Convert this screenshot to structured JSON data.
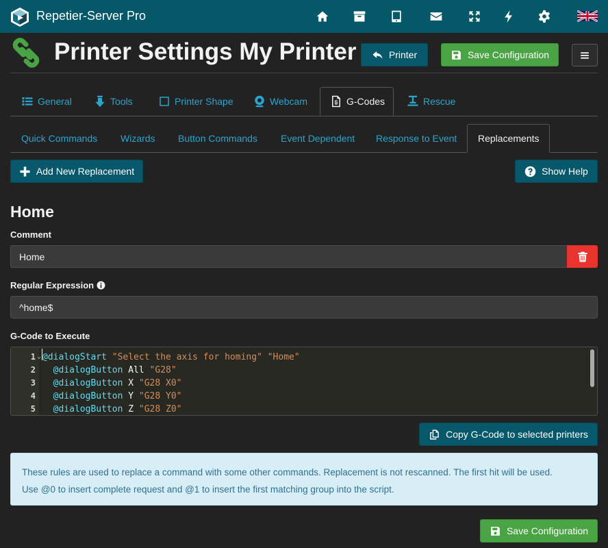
{
  "app": {
    "title": "Repetier-Server Pro"
  },
  "nav_icons": [
    "home-icon",
    "archive-icon",
    "tablet-icon",
    "envelope-icon",
    "expand-icon",
    "bolt-icon",
    "gear-icon",
    "uk-flag-icon"
  ],
  "header": {
    "title": "Printer Settings My Printer",
    "printer_button": "Printer",
    "save_button": "Save Configuration"
  },
  "tabs": [
    {
      "label": "General",
      "icon": "list-icon"
    },
    {
      "label": "Tools",
      "icon": "arrow-down-icon"
    },
    {
      "label": "Printer Shape",
      "icon": "square-icon"
    },
    {
      "label": "Webcam",
      "icon": "webcam-icon"
    },
    {
      "label": "G-Codes",
      "icon": "gcode-file-icon",
      "active": true
    },
    {
      "label": "Rescue",
      "icon": "rescue-icon"
    }
  ],
  "subtabs": [
    {
      "label": "Quick Commands"
    },
    {
      "label": "Wizards"
    },
    {
      "label": "Button Commands"
    },
    {
      "label": "Event Dependent"
    },
    {
      "label": "Response to Event"
    },
    {
      "label": "Replacements",
      "active": true
    }
  ],
  "actions": {
    "add_replacement": "Add New Replacement",
    "show_help": "Show Help",
    "copy_gcode": "Copy G-Code to selected printers",
    "save_bottom": "Save Configuration"
  },
  "replacement": {
    "heading": "Home",
    "comment_label": "Comment",
    "comment_value": "Home",
    "regex_label": "Regular Expression",
    "regex_value": "^home$",
    "gcode_label": "G-Code to Execute"
  },
  "code_lines": [
    {
      "n": "1",
      "parts": [
        {
          "t": "@dialogStart",
          "c": "kw"
        },
        {
          "t": " ",
          "c": ""
        },
        {
          "t": "\"Select the axis for homing\"",
          "c": "str2"
        },
        {
          "t": " ",
          "c": ""
        },
        {
          "t": "\"Home\"",
          "c": "str2"
        }
      ]
    },
    {
      "n": "2",
      "parts": [
        {
          "t": "  ",
          "c": ""
        },
        {
          "t": "@dialogButton",
          "c": "kw"
        },
        {
          "t": " All ",
          "c": ""
        },
        {
          "t": "\"G28\"",
          "c": "str2"
        }
      ]
    },
    {
      "n": "3",
      "parts": [
        {
          "t": "  ",
          "c": ""
        },
        {
          "t": "@dialogButton",
          "c": "kw"
        },
        {
          "t": " X ",
          "c": ""
        },
        {
          "t": "\"G28 X0\"",
          "c": "str2"
        }
      ]
    },
    {
      "n": "4",
      "parts": [
        {
          "t": "  ",
          "c": ""
        },
        {
          "t": "@dialogButton",
          "c": "kw"
        },
        {
          "t": " Y ",
          "c": ""
        },
        {
          "t": "\"G28 Y0\"",
          "c": "str2"
        }
      ]
    },
    {
      "n": "5",
      "parts": [
        {
          "t": "  ",
          "c": ""
        },
        {
          "t": "@dialogButton",
          "c": "kw"
        },
        {
          "t": " Z ",
          "c": ""
        },
        {
          "t": "\"G28 Z0\"",
          "c": "str2"
        }
      ]
    }
  ],
  "info": {
    "line1": "These rules are used to replace a command with some other commands. Replacement is not rescanned. The first hit will be used.",
    "line2": "Use @0 to insert complete request and @1 to insert the first matching group into the script."
  },
  "colors": {
    "navbar": "#055868",
    "background": "#222222",
    "accent_link": "#2aa5cf",
    "primary_button": "#06586a",
    "success_button": "#4ba444",
    "danger_button": "#e8332e",
    "info_box": "#d8eef7"
  }
}
